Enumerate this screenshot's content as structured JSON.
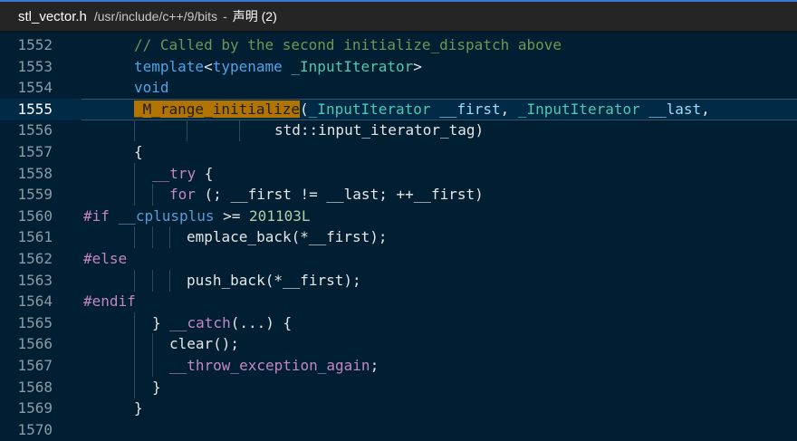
{
  "header": {
    "filename": "stl_vector.h",
    "path": "/usr/include/c++/9/bits",
    "separator": "-",
    "declaration_label": "声明 (2)"
  },
  "editor": {
    "active_line": "1555",
    "lines": [
      {
        "n": "1552",
        "t": [
          [
            "cm",
            "// Called by the second initialize_dispatch above"
          ]
        ]
      },
      {
        "n": "1553",
        "t": [
          [
            "kw",
            "template"
          ],
          [
            "op",
            "<"
          ],
          [
            "kw",
            "typename"
          ],
          [
            "op",
            " "
          ],
          [
            "ty",
            "_InputIterator"
          ],
          [
            "op",
            ">"
          ]
        ]
      },
      {
        "n": "1554",
        "t": [
          [
            "kw",
            "void"
          ]
        ]
      },
      {
        "n": "1555",
        "t": [
          [
            "hl",
            "_M_range_initialize"
          ],
          [
            "op",
            "("
          ],
          [
            "ty",
            "_InputIterator"
          ],
          [
            "op",
            " "
          ],
          [
            "id",
            "__first"
          ],
          [
            "op",
            ", "
          ],
          [
            "ty",
            "_InputIterator"
          ],
          [
            "op",
            " "
          ],
          [
            "id",
            "__last"
          ],
          [
            "op",
            ","
          ]
        ]
      },
      {
        "n": "1556",
        "t": [
          [
            "op",
            "std::input_iterator_tag)"
          ]
        ]
      },
      {
        "n": "1557",
        "t": [
          [
            "op",
            "{"
          ]
        ]
      },
      {
        "n": "1558",
        "t": [
          [
            "ctl",
            "__try"
          ],
          [
            "op",
            " {"
          ]
        ]
      },
      {
        "n": "1559",
        "t": [
          [
            "ctl",
            "for"
          ],
          [
            "op",
            " (; __first != __last; ++__first)"
          ]
        ]
      },
      {
        "n": "1560",
        "t": [
          [
            "pre",
            "#if"
          ],
          [
            "op",
            " "
          ],
          [
            "mac",
            "__cplusplus"
          ],
          [
            "op",
            " >= "
          ],
          [
            "num",
            "201103L"
          ]
        ]
      },
      {
        "n": "1561",
        "t": [
          [
            "fnw",
            "emplace_back(*__first);"
          ]
        ]
      },
      {
        "n": "1562",
        "t": [
          [
            "pre",
            "#else"
          ]
        ]
      },
      {
        "n": "1563",
        "t": [
          [
            "fnw",
            "push_back(*__first);"
          ]
        ]
      },
      {
        "n": "1564",
        "t": [
          [
            "pre",
            "#endif"
          ]
        ]
      },
      {
        "n": "1565",
        "t": [
          [
            "op",
            "} "
          ],
          [
            "ctl",
            "__catch"
          ],
          [
            "op",
            "(...) {"
          ]
        ]
      },
      {
        "n": "1566",
        "t": [
          [
            "fnw",
            "clear();"
          ]
        ]
      },
      {
        "n": "1567",
        "t": [
          [
            "ctl",
            "__throw_exception_again"
          ],
          [
            "op",
            ";"
          ]
        ]
      },
      {
        "n": "1568",
        "t": [
          [
            "op",
            "}"
          ]
        ]
      },
      {
        "n": "1569",
        "t": [
          [
            "op",
            "}"
          ]
        ]
      },
      {
        "n": "1570",
        "t": []
      }
    ]
  },
  "colors": {
    "background": "#001f33",
    "highlight": "#b27400",
    "comment": "#6a9955",
    "keyword": "#4fa3e8",
    "type": "#4ec9b0",
    "control": "#c586c0"
  }
}
